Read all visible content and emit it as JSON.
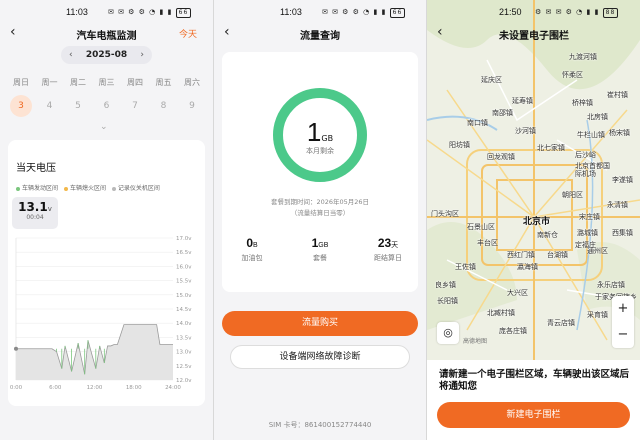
{
  "battery_panel": {
    "status_time": "11:03",
    "battery_level": "66",
    "title": "汽车电瓶监测",
    "today_label": "今天",
    "month": "2025-08",
    "weekdays": [
      "周日",
      "周一",
      "周二",
      "周三",
      "周四",
      "周五",
      "周六"
    ],
    "days": [
      "3",
      "4",
      "5",
      "6",
      "7",
      "8",
      "9"
    ],
    "selected_day_index": 0,
    "card_title": "当天电压",
    "legend": [
      {
        "label": "车辆发动区间",
        "color": "#7bc67e"
      },
      {
        "label": "车辆熄火区间",
        "color": "#f2b84b"
      },
      {
        "label": "记录仪关机区间",
        "color": "#b9b9b9"
      }
    ],
    "current_voltage": "13.1",
    "voltage_unit": "v",
    "current_time": "00:04",
    "chart_data": {
      "type": "line",
      "x_ticks": [
        "0:00",
        "6:00",
        "12:00",
        "18:00",
        "24:00"
      ],
      "y_ticks": [
        "17.0v",
        "16.5v",
        "16.0v",
        "15.5v",
        "15.0v",
        "14.5v",
        "14.0v",
        "13.5v",
        "13.0v",
        "12.5v",
        "12.0v"
      ],
      "ylim": [
        12.0,
        17.0
      ],
      "xlim": [
        0,
        24
      ],
      "series": [
        {
          "x": [
            0,
            5.5,
            6.2,
            7,
            7.5,
            8.5,
            9.5,
            10.5,
            11,
            12.2,
            12.8,
            13.5,
            14,
            14.5,
            15,
            15.5,
            16.5,
            17.5,
            18.5,
            19.5,
            20.5,
            21.5,
            22,
            23,
            24
          ],
          "y": [
            13.1,
            13.1,
            13.0,
            12.4,
            13.2,
            12.3,
            13.3,
            12.2,
            13.4,
            12.4,
            13.2,
            12.6,
            13.2,
            13.2,
            13.25,
            13.25,
            13.95,
            13.95,
            13.95,
            13.95,
            13.95,
            13.95,
            13.25,
            13.25,
            13.25
          ]
        }
      ]
    }
  },
  "data_panel": {
    "status_time": "11:03",
    "battery_level": "66",
    "title": "流量查询",
    "remaining_value": "1",
    "remaining_unit": "GB",
    "remaining_label": "本月剩余",
    "remaining_fraction": 1.0,
    "ring_color": "#4cc98a",
    "expire_line1": "套餐到期时间：2026年05月26日",
    "expire_line2": "（流量结算日当零）",
    "stats": [
      {
        "value": "0",
        "unit": "B",
        "label": "加油包"
      },
      {
        "value": "1",
        "unit": "GB",
        "label": "套餐"
      },
      {
        "value": "23",
        "unit": "天",
        "label": "距结算日"
      }
    ],
    "buy_button": "流量购买",
    "diag_button": "设备端网络故障诊断",
    "sim_label": "SIM 卡号：861400152774440"
  },
  "geofence_panel": {
    "status_time": "21:50",
    "battery_level": "88",
    "title": "未设置电子围栏",
    "map_labels": [
      "九渡河镇",
      "延庆区",
      "怀柔区",
      "桥梓镇",
      "北房镇",
      "延寿镇",
      "崔村镇",
      "南口镇",
      "沙河镇",
      "牛栏山镇",
      "杨宋镇",
      "南邵镇",
      "北七家镇",
      "后沙峪",
      "北京首都国际机场",
      "阳坊镇",
      "回龙观镇",
      "李遂镇",
      "西集镇",
      "朝阳区",
      "永清镇",
      "门头沟区",
      "北京市",
      "石景山区",
      "南新仓",
      "潞城镇",
      "宋庄镇",
      "永乐店镇",
      "丰台区",
      "台湖镇",
      "王佐镇",
      "瀛海镇",
      "大兴区",
      "于家务回族乡",
      "良乡镇",
      "通州区",
      "西红门镇",
      "北臧村镇",
      "采育镇",
      "长阳镇",
      "庞各庄镇",
      "青云店镇",
      "定福庄"
    ],
    "map_logo": "高德地图",
    "zoom_in": "+",
    "zoom_out": "−",
    "message": "请新建一个电子围栏区域，车辆驶出该区域后将通知您",
    "new_button": "新建电子围栏"
  }
}
